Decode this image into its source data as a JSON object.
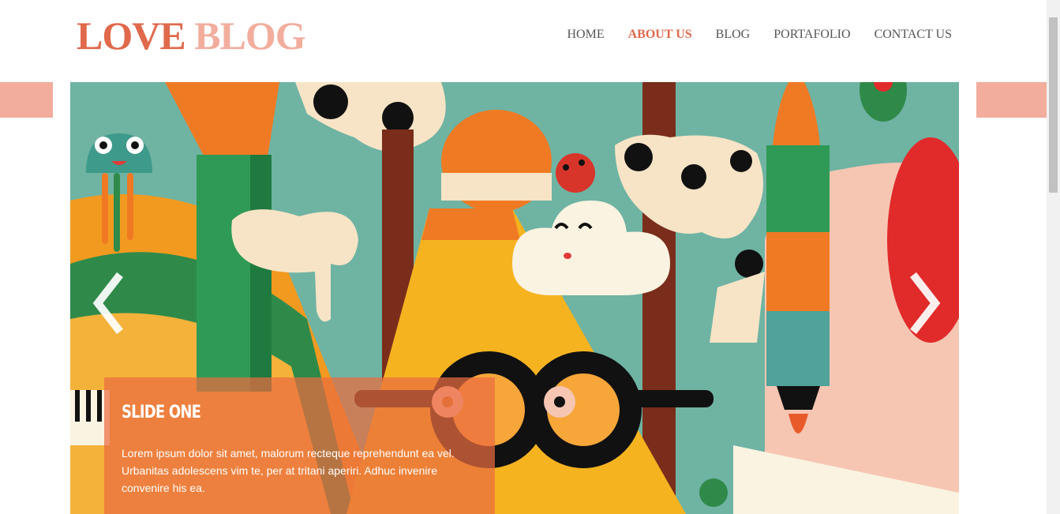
{
  "logo": {
    "word1": "LOVE",
    "word2": "BLOG"
  },
  "nav": {
    "items": [
      {
        "label": "HOME"
      },
      {
        "label": "ABOUT US"
      },
      {
        "label": "BLOG"
      },
      {
        "label": "PORTAFOLIO"
      },
      {
        "label": "CONTACT US"
      }
    ],
    "active": "ABOUT US"
  },
  "slider": {
    "caption_title": "SLIDE ONE",
    "caption_text": "Lorem ipsum dolor sit amet, malorum recteque reprehendunt ea vel. Urbanitas adolescens vim te, per at tritani aperiri. Adhuc invenire convenire his ea.",
    "prev_icon": "chevron-left-icon",
    "next_icon": "chevron-right-icon"
  },
  "colors": {
    "logo_primary": "#e0694c",
    "logo_secondary": "#f2ad9d",
    "accent_bar": "#f2ad9d",
    "caption_bg": "#ea6c40"
  }
}
